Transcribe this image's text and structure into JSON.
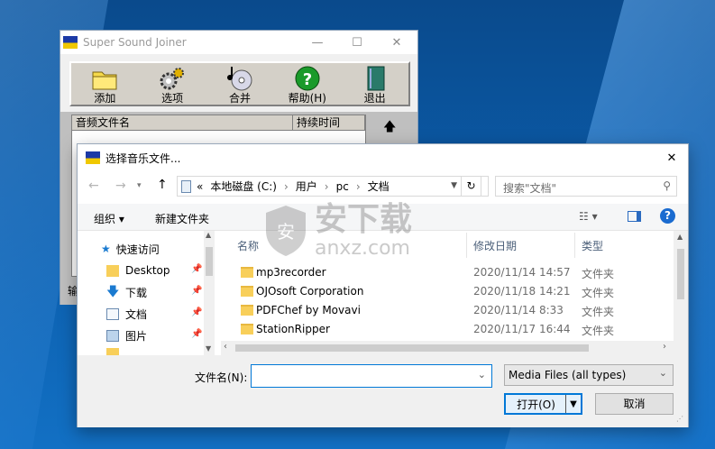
{
  "old_window": {
    "title": "Super Sound Joiner",
    "toolbar": [
      {
        "label": "添加",
        "icon": "folder-icon"
      },
      {
        "label": "选项",
        "icon": "gears-icon"
      },
      {
        "label": "合并",
        "icon": "cd-music-icon"
      },
      {
        "label": "帮助(H)",
        "icon": "help-icon"
      },
      {
        "label": "退出",
        "icon": "exit-book-icon"
      }
    ],
    "list_headers": [
      "音频文件名",
      "持续时间"
    ],
    "cut_text": "输"
  },
  "dialog": {
    "title": "选择音乐文件...",
    "breadcrumb": [
      "«",
      "本地磁盘 (C:)",
      "›",
      "用户",
      "›",
      "pc",
      "›",
      "文档"
    ],
    "search_placeholder": "搜索\"文档\"",
    "organize": "组织 ▾",
    "new_folder": "新建文件夹",
    "quick_access": "快速访问",
    "nav": [
      {
        "label": "Desktop",
        "icon": "folder-icon"
      },
      {
        "label": "下载",
        "icon": "download-icon"
      },
      {
        "label": "文档",
        "icon": "document-icon"
      },
      {
        "label": "图片",
        "icon": "picture-icon"
      }
    ],
    "columns": {
      "name": "名称",
      "date": "修改日期",
      "type": "类型"
    },
    "files": [
      {
        "name": "mp3recorder",
        "date": "2020/11/14 14:57",
        "type": "文件夹"
      },
      {
        "name": "OJOsoft Corporation",
        "date": "2020/11/18 14:21",
        "type": "文件夹"
      },
      {
        "name": "PDFChef by Movavi",
        "date": "2020/11/14 8:33",
        "type": "文件夹"
      },
      {
        "name": "StationRipper",
        "date": "2020/11/17 16:44",
        "type": "文件夹"
      }
    ],
    "filename_label": "文件名(N):",
    "filename_value": "",
    "filetype": "Media Files (all types)",
    "open": "打开(O)",
    "cancel": "取消"
  },
  "watermark": {
    "cn": "安下载",
    "en": "anxz.com"
  }
}
